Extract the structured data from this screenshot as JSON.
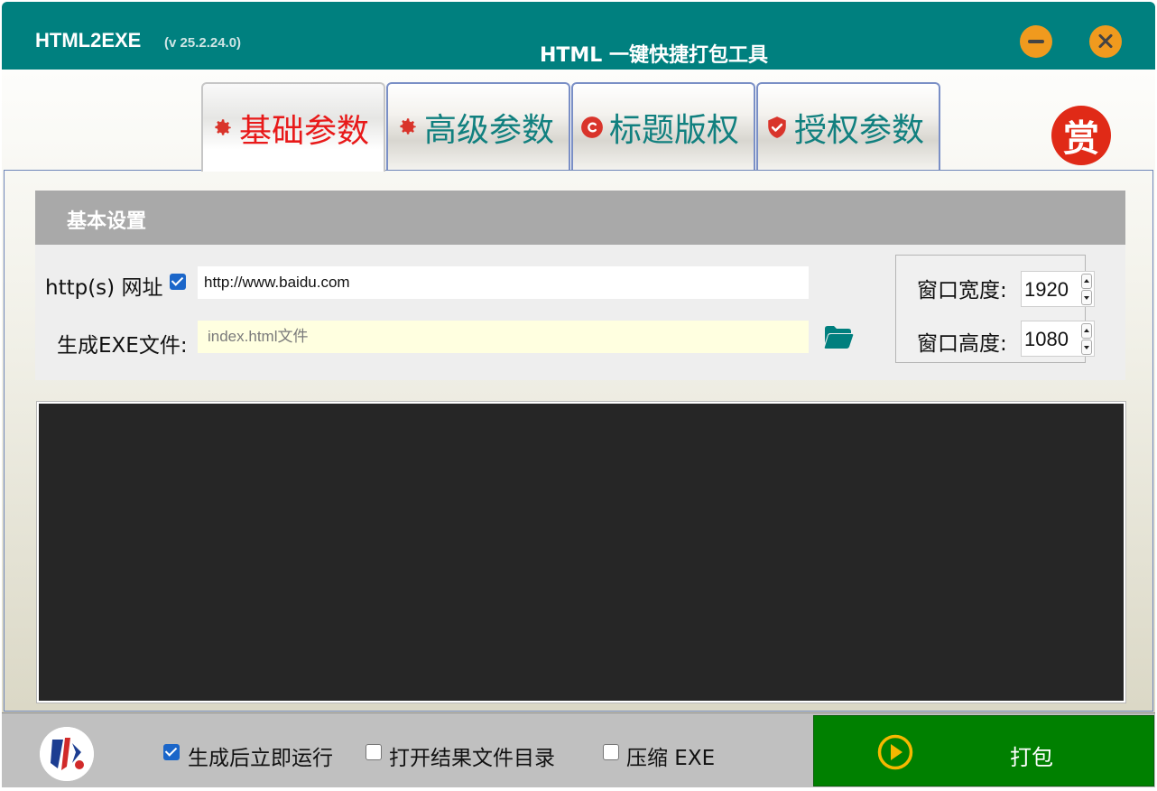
{
  "window": {
    "app_name": "HTML2EXE",
    "version": "(v 25.2.24.0)",
    "subtitle": "HTML 一键快捷打包工具"
  },
  "tabs": [
    {
      "label": "基础参数",
      "icon": "gear-icon",
      "active": true
    },
    {
      "label": "高级参数",
      "icon": "gear-icon",
      "active": false
    },
    {
      "label": "标题版权",
      "icon": "copyright-icon",
      "active": false
    },
    {
      "label": "授权参数",
      "icon": "shield-check-icon",
      "active": false
    }
  ],
  "reward_label": "赏",
  "basic_settings": {
    "title": "基本设置",
    "url_label": "http(s) 网址",
    "url_enabled": true,
    "url_value": "http://www.baidu.com",
    "exe_label": "生成EXE文件:",
    "exe_placeholder": "index.html文件",
    "width_label": "窗口宽度:",
    "width_value": "1920",
    "height_label": "窗口高度:",
    "height_value": "1080"
  },
  "options": {
    "run_after": {
      "label": "生成后立即运行",
      "checked": true
    },
    "open_dir": {
      "label": "打开结果文件目录",
      "checked": false
    },
    "compress": {
      "label": "压缩 EXE",
      "checked": false
    }
  },
  "pack_button": {
    "label": "打包"
  },
  "colors": {
    "titlebar": "#00807f",
    "tab_active_text": "#e81919",
    "tab_text": "#11807f",
    "pack_button": "#008000",
    "window_button": "#f09a1e",
    "reward": "#e02a17"
  }
}
